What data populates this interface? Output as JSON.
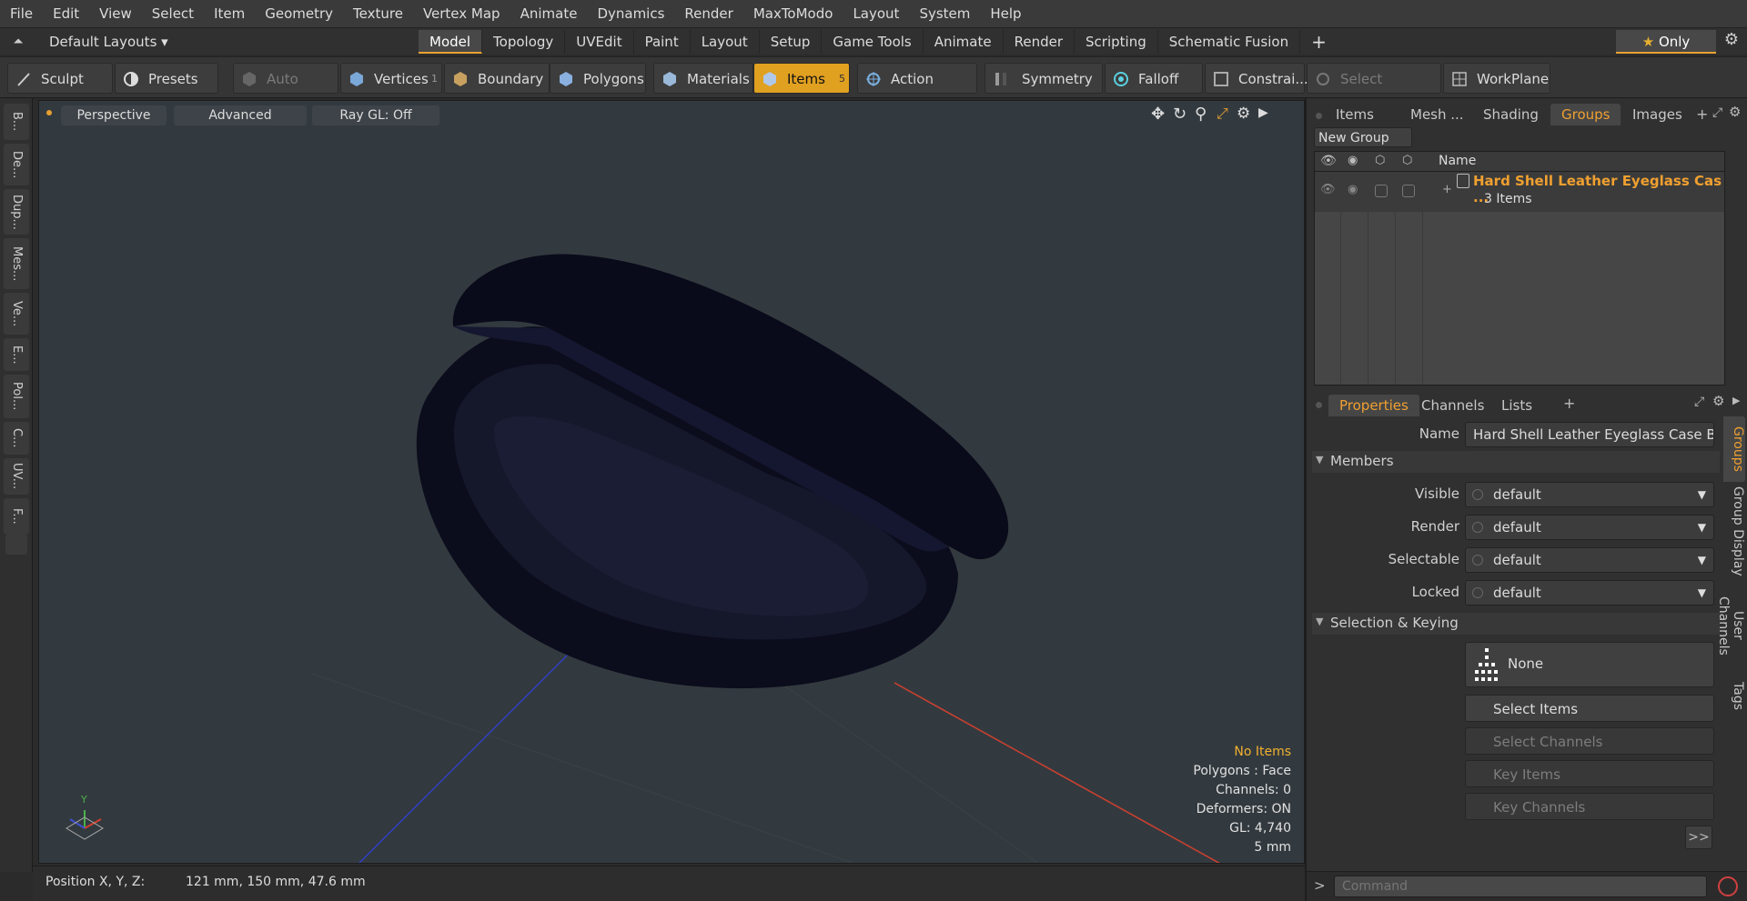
{
  "menu": [
    "File",
    "Edit",
    "View",
    "Select",
    "Item",
    "Geometry",
    "Texture",
    "Vertex Map",
    "Animate",
    "Dynamics",
    "Render",
    "MaxToModo",
    "Layout",
    "System",
    "Help"
  ],
  "layout": {
    "preset": "Default Layouts ▾",
    "tabs": [
      "Model",
      "Topology",
      "UVEdit",
      "Paint",
      "Layout",
      "Setup",
      "Game Tools",
      "Animate",
      "Render",
      "Scripting",
      "Schematic Fusion"
    ],
    "active_tab": "Model",
    "add": "+",
    "only": "Only"
  },
  "toolbar": {
    "sculpt": "Sculpt",
    "presets": "Presets",
    "auto_select": "Auto Select",
    "vertices": "Vertices",
    "vertices_count": "1",
    "boundary": "Boundary",
    "polygons": "Polygons",
    "materials": "Materials",
    "items": "Items",
    "items_count": "5",
    "action_center": "Action Center",
    "symmetry": "Symmetry",
    "falloff": "Falloff",
    "constraints": "Constrai...",
    "select_through": "Select Through",
    "workplane": "WorkPlane"
  },
  "left_tabs": [
    "B...",
    "De...",
    "Dup...",
    "Mes...",
    "Ve...",
    "E...",
    "Pol...",
    "C...",
    "UV...",
    "F..."
  ],
  "viewport": {
    "view_mode": "Perspective",
    "shading": "Advanced",
    "raygl": "Ray GL: Off",
    "info": {
      "no_items": "No Items",
      "polygons": "Polygons : Face",
      "channels": "Channels: 0",
      "deformers": "Deformers: ON",
      "gl": "GL: 4,740",
      "scale": "5 mm"
    },
    "axis_y": "Y"
  },
  "status": {
    "position_label": "Position X, Y, Z:",
    "position_value": "121 mm, 150 mm, 47.6 mm"
  },
  "groups_panel": {
    "tabs": [
      "Items",
      "Mesh ...",
      "Shading",
      "Groups",
      "Images"
    ],
    "active_tab": "Groups",
    "new_group": "New Group",
    "column_name": "Name",
    "group_name": "Hard Shell Leather Eyeglass Cas ...",
    "group_count": "3 Items"
  },
  "properties": {
    "tabs": [
      "Properties",
      "Channels",
      "Lists"
    ],
    "active_tab": "Properties",
    "name_label": "Name",
    "name_value": "Hard Shell Leather Eyeglass Case Blac",
    "members_header": "Members",
    "visible_label": "Visible",
    "visible_value": "default",
    "render_label": "Render",
    "render_value": "default",
    "selectable_label": "Selectable",
    "selectable_value": "default",
    "locked_label": "Locked",
    "locked_value": "default",
    "selection_header": "Selection & Keying",
    "none_btn": "None",
    "select_items": "Select Items",
    "select_channels": "Select Channels",
    "key_items": "Key Items",
    "key_channels": "Key Channels",
    "more": ">>",
    "side_tabs": [
      "Groups",
      "Group Display",
      "User Channels",
      "Tags"
    ]
  },
  "command": {
    "placeholder": "Command",
    "prompt": ">"
  },
  "colors": {
    "accent": "#e8a030",
    "viewport_bg": "#333a3f",
    "mesh": "#0b0c1c",
    "axis_x": "#d04030",
    "axis_z": "#3040c0"
  }
}
